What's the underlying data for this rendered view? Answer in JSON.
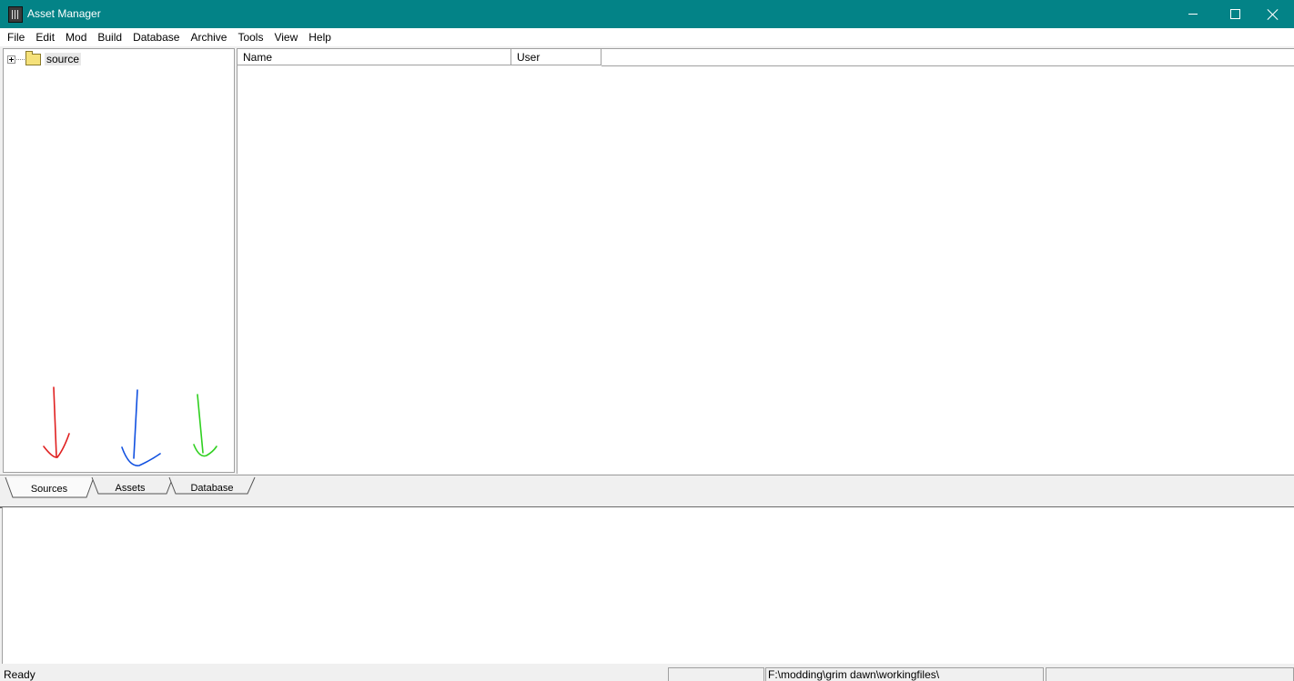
{
  "window": {
    "title": "Asset Manager",
    "title_bar_color": "#038387"
  },
  "menu": [
    "File",
    "Edit",
    "Mod",
    "Build",
    "Database",
    "Archive",
    "Tools",
    "View",
    "Help"
  ],
  "tree": {
    "root_label": "source",
    "root_icon": "folder-icon"
  },
  "list": {
    "columns": [
      "Name",
      "User"
    ]
  },
  "tabs": [
    "Sources",
    "Assets",
    "Database"
  ],
  "annotations": {
    "arrow_colors": [
      "#e02020",
      "#1050e0",
      "#30d020"
    ]
  },
  "status": {
    "text": "Ready",
    "path": "F:\\modding\\grim dawn\\workingfiles\\"
  }
}
